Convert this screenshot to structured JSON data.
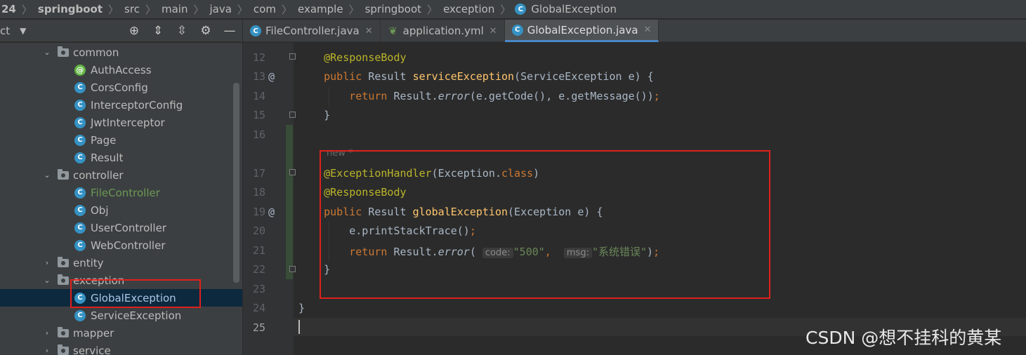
{
  "breadcrumb": [
    "24",
    "springboot",
    "src",
    "main",
    "java",
    "com",
    "example",
    "springboot",
    "exception",
    "GlobalException"
  ],
  "project_toolbar": {
    "title": "ct"
  },
  "tabs": [
    {
      "label": "FileController.java",
      "icon": "class-icon",
      "active": false
    },
    {
      "label": "application.yml",
      "icon": "spring-leaf-icon",
      "active": false
    },
    {
      "label": "GlobalException.java",
      "icon": "class-icon",
      "active": true
    }
  ],
  "tree": {
    "common": "common",
    "authaccess": "AuthAccess",
    "corsconfig": "CorsConfig",
    "interceptorconfig": "InterceptorConfig",
    "jwtinterceptor": "JwtInterceptor",
    "page": "Page",
    "result": "Result",
    "controller": "controller",
    "filecontroller": "FileController",
    "obj": "Obj",
    "usercontroller": "UserController",
    "webcontroller": "WebController",
    "entity": "entity",
    "exception": "exception",
    "globalexception": "GlobalException",
    "serviceexception": "ServiceException",
    "mapper": "mapper",
    "service": "service"
  },
  "code": {
    "line_numbers": [
      "12",
      "13",
      "14",
      "15",
      "16",
      "17",
      "18",
      "19",
      "20",
      "21",
      "22",
      "23",
      "24",
      "25"
    ],
    "new_hint": "new *",
    "l12_anno": "@ResponseBody",
    "l13_public": "public",
    "l13_type": "Result",
    "l13_fn": "serviceException",
    "l13_params": "(ServiceException e) {",
    "l14_return": "return",
    "l14_call": "Result.",
    "l14_error": "error",
    "l14_args": "(e.getCode(), e.getMessage())",
    "l14_semi": ";",
    "l15": "}",
    "l17_anno": "@ExceptionHandler",
    "l17_args": "(Exception.",
    "l17_class": "class",
    "l17_close": ")",
    "l18_anno": "@ResponseBody",
    "l19_public": "public",
    "l19_type": "Result",
    "l19_fn": "globalException",
    "l19_params": "(Exception e) {",
    "l20_call": "e.printStackTrace()",
    "l20_semi": ";",
    "l21_return": "return",
    "l21_call": "Result.",
    "l21_error": "error",
    "l21_open": "(",
    "l21_hint_code": "code:",
    "l21_code_val": "\"500\"",
    "l21_comma": ",",
    "l21_hint_msg": "msg:",
    "l21_msg_val": "\"系统错误\"",
    "l21_close": ")",
    "l21_semi": ";",
    "l22": "}",
    "l24": "}"
  },
  "watermark": "CSDN @想不挂科的黄某"
}
